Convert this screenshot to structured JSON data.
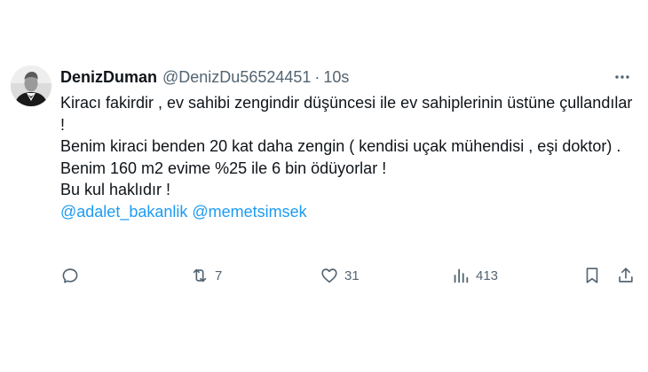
{
  "tweet": {
    "display_name": "DenizDuman",
    "handle": "@DenizDu56524451",
    "separator": "·",
    "time": "10s",
    "lines": [
      "Kiracı fakirdir , ev sahibi zengindir düşüncesi ile  ev sahiplerinin üstüne çullandılar !",
      "Benim kiraci benden 20 kat daha zengin ( kendisi uçak mühendisi , eşi doktor) .",
      "Benim 160 m2 evime %25 ile 6 bin ödüyorlar !",
      "Bu kul haklıdır !"
    ],
    "mentions": [
      "@adalet_bakanlik",
      "@memetsimsek"
    ],
    "actions": {
      "reply_icon": "reply-icon",
      "retweet_icon": "retweet-icon",
      "retweet_count": "7",
      "like_icon": "heart-icon",
      "like_count": "31",
      "views_icon": "views-chart-icon",
      "views_count": "413",
      "bookmark_icon": "bookmark-icon",
      "share_icon": "share-icon"
    }
  },
  "colors": {
    "text": "#0f1419",
    "secondary": "#536471",
    "link": "#1d9bf0",
    "background": "#ffffff"
  }
}
